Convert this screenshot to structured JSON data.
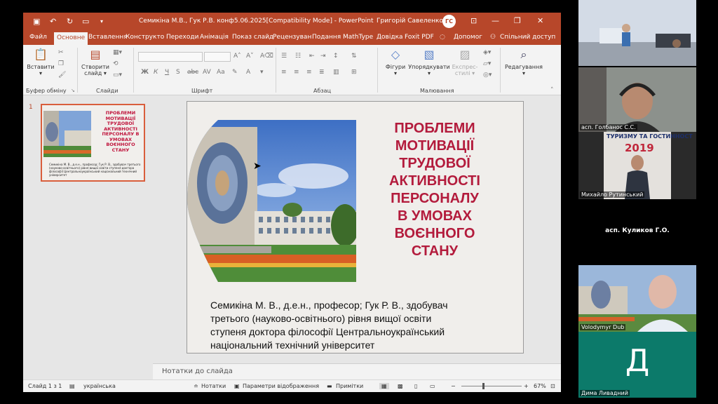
{
  "titlebar": {
    "title": "Семикіна М.В., Гук Р.В. конф5.06.2025[Compatibility Mode] - PowerPoint",
    "user_name": "Григорій Савеленко",
    "user_initials": "ГС"
  },
  "tabs": [
    "Файл",
    "Основне",
    "Вставлення",
    "Конструкто",
    "Переходи",
    "Анімація",
    "Показ слайд",
    "Рецензуван",
    "Подання",
    "MathType",
    "Довідка",
    "Foxit PDF"
  ],
  "help": {
    "search_label": "Допомог",
    "share_label": "Спільний доступ"
  },
  "ribbon": {
    "paste_label": "Вставити",
    "clipboard_group": "Буфер обміну",
    "new_slide_label": "Створити",
    "new_slide_label2": "слайд",
    "slides_group": "Слайди",
    "font_group": "Шрифт",
    "paragraph_group": "Абзац",
    "shapes_label": "Фігури",
    "arrange_label": "Упорядкувати",
    "styles_label": "Експрес-",
    "styles_label2": "стилі",
    "drawing_group": "Малювання",
    "editing_label": "Редагування"
  },
  "thumbnail": {
    "number": "1",
    "title": "ПРОБЛЕМИ МОТИВАЦІЇ ТРУДОВОЇ АКТИВНОСТІ ПЕРСОНАЛУ В УМОВАХ ВОЄННОГО СТАНУ",
    "desc": "Семикіна М. В., д.е.н., професор; Гук Р. В., здобувач третього (науково-освітнього) рівня вищої освіти ступеня доктора філософії Центральноукраїнський національний технічний університет"
  },
  "slide": {
    "title_lines": [
      "ПРОБЛЕМИ",
      "МОТИВАЦІЇ",
      "ТРУДОВОЇ",
      "АКТИВНОСТІ",
      "ПЕРСОНАЛУ",
      "В УМОВАХ",
      "ВОЄННОГО",
      "СТАНУ"
    ],
    "desc_lines": [
      "Семикіна М. В., д.е.н., професор; Гук Р. В., здобувач",
      "третього (науково-освітнього) рівня вищої освіти",
      "ступеня доктора філософії Центральноукраїнський",
      "національний технічний університет"
    ]
  },
  "notes_label": "Нотатки до слайда",
  "status": {
    "slide_count": "Слайд 1 з 1",
    "language": "українська",
    "notes_btn": "Нотатки",
    "display_btn": "Параметри відображення",
    "comments_btn": "Примітки",
    "zoom": "67%"
  },
  "participants": [
    {
      "name": "",
      "bg": "#c9d4e2"
    },
    {
      "name": "асп. Голбанос С.С.",
      "bg": "#8a8f8a"
    },
    {
      "name": "Михайло Рутинський",
      "bg": "#b8b3ae",
      "banner": "ТУРИЗМУ ТА ГОСТИННОСТ",
      "year": "2019"
    },
    {
      "name": "асп. Куликов Г.О.",
      "bg": "#000000"
    },
    {
      "name": "Volodymyr Dub",
      "bg": "#8fa7c4"
    },
    {
      "name": "Дима Ливадний",
      "bg": "#0c7a6a",
      "initial": "Д"
    }
  ]
}
